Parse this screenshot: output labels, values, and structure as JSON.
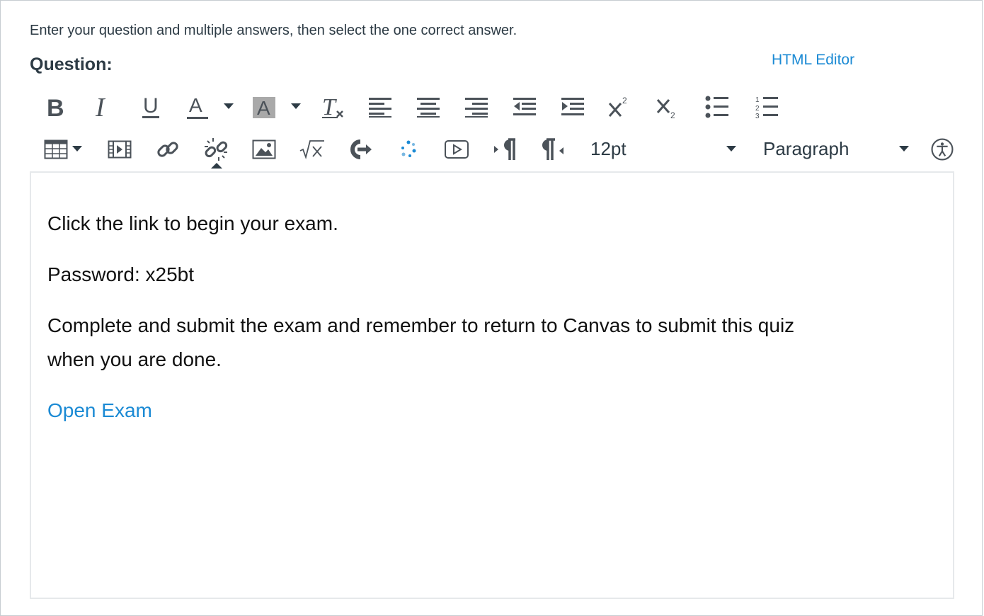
{
  "instructions": "Enter your question and multiple answers, then select the one correct answer.",
  "question_label": "Question:",
  "html_editor_link": "HTML Editor",
  "toolbar": {
    "row1": [
      "bold-icon",
      "italic-icon",
      "underline-icon",
      "text-color-icon",
      "background-color-icon",
      "clear-formatting-icon",
      "align-left-icon",
      "align-center-icon",
      "align-right-icon",
      "outdent-icon",
      "indent-icon",
      "superscript-icon",
      "subscript-icon",
      "bulleted-list-icon",
      "numbered-list-icon"
    ],
    "row2": [
      "table-icon",
      "media-icon",
      "link-icon",
      "unlink-icon",
      "image-icon",
      "equation-icon",
      "lti-tool-icon",
      "loading-spinner-icon",
      "embed-video-icon",
      "ltr-paragraph-icon",
      "rtl-paragraph-icon",
      "accessibility-icon"
    ],
    "font_size": "12pt",
    "block_format": "Paragraph"
  },
  "editor": {
    "line1": "Click the link to begin your exam.",
    "line2": "Password: x25bt",
    "line3a": "Complete and submit the exam and remember to return to Canvas to submit this quiz",
    "line3b": "when you are done.",
    "link_text": "Open Exam"
  },
  "colors": {
    "link": "#1b8ad4",
    "text": "#2d3b45",
    "border": "#c7cdd1"
  }
}
